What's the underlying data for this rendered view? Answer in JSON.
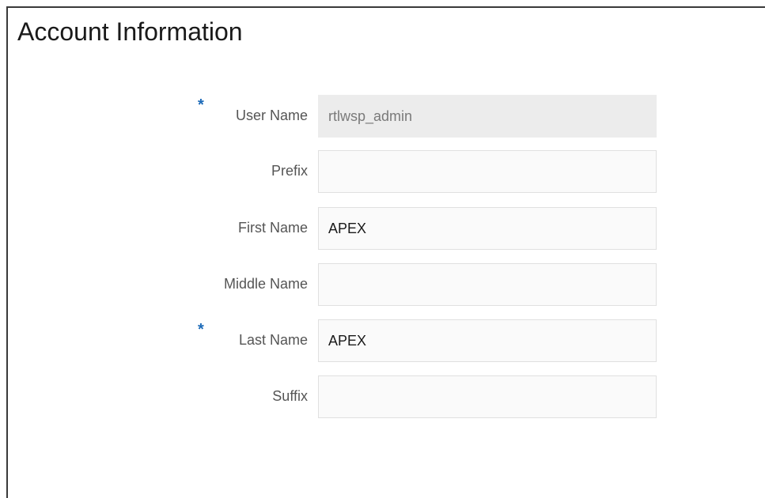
{
  "page": {
    "title": "Account Information"
  },
  "form": {
    "fields": [
      {
        "label": "User Name",
        "value": "rtlwsp_admin",
        "required": true,
        "readonly": true
      },
      {
        "label": "Prefix",
        "value": "",
        "required": false,
        "readonly": false
      },
      {
        "label": "First Name",
        "value": "APEX",
        "required": false,
        "readonly": false
      },
      {
        "label": "Middle Name",
        "value": "",
        "required": false,
        "readonly": false
      },
      {
        "label": "Last Name",
        "value": "APEX",
        "required": true,
        "readonly": false
      },
      {
        "label": "Suffix",
        "value": "",
        "required": false,
        "readonly": false
      }
    ],
    "required_symbol": "*",
    "required_color": "#1c6ab8"
  }
}
